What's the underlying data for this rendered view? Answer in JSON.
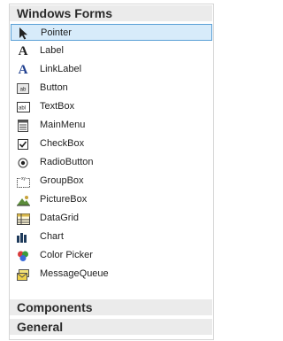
{
  "sections": {
    "windows_forms": "Windows Forms",
    "components": "Components",
    "general": "General"
  },
  "items": [
    {
      "label": "Pointer",
      "icon": "pointer-icon",
      "selected": true
    },
    {
      "label": "Label",
      "icon": "label-icon"
    },
    {
      "label": "LinkLabel",
      "icon": "linklabel-icon"
    },
    {
      "label": "Button",
      "icon": "button-icon"
    },
    {
      "label": "TextBox",
      "icon": "textbox-icon"
    },
    {
      "label": "MainMenu",
      "icon": "mainmenu-icon"
    },
    {
      "label": "CheckBox",
      "icon": "checkbox-icon"
    },
    {
      "label": "RadioButton",
      "icon": "radiobutton-icon"
    },
    {
      "label": "GroupBox",
      "icon": "groupbox-icon"
    },
    {
      "label": "PictureBox",
      "icon": "picturebox-icon"
    },
    {
      "label": "DataGrid",
      "icon": "datagrid-icon"
    },
    {
      "label": "Chart",
      "icon": "chart-icon"
    },
    {
      "label": "Color Picker",
      "icon": "color-picker-icon"
    },
    {
      "label": "MessageQueue",
      "icon": "messagequeue-icon"
    }
  ],
  "colors": {
    "selection_fill": "#d7ebfa",
    "selection_border": "#5aa0d6",
    "header_bg": "#ebebeb"
  }
}
